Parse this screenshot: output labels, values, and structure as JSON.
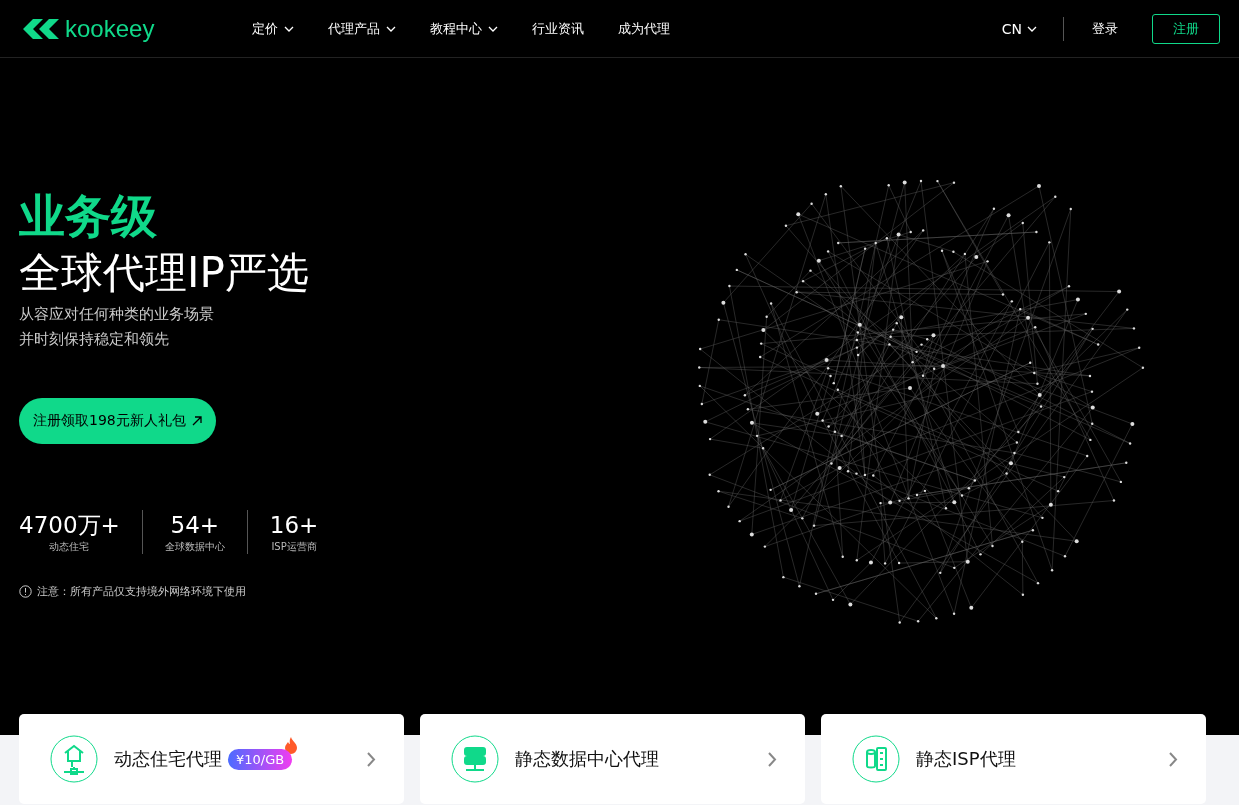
{
  "header": {
    "logo": "kookeey",
    "nav": [
      {
        "label": "定价",
        "dropdown": true
      },
      {
        "label": "代理产品",
        "dropdown": true
      },
      {
        "label": "教程中心",
        "dropdown": true
      },
      {
        "label": "行业资讯",
        "dropdown": false
      },
      {
        "label": "成为代理",
        "dropdown": false
      }
    ],
    "language": "CN",
    "login": "登录",
    "register": "注册"
  },
  "hero": {
    "headline_accent": "业务级",
    "headline": "全球代理IP严选",
    "subtitle_lines": [
      "从容应对任何种类的业务场景",
      "并时刻保持稳定和领先"
    ],
    "cta": "注册领取198元新人礼包",
    "stats": [
      {
        "value": "4700万+",
        "label": "动态住宅"
      },
      {
        "value": "54+",
        "label": "全球数据中心"
      },
      {
        "value": "16+",
        "label": "ISP运营商"
      }
    ],
    "notice": "注意：所有产品仅支持境外网络环境下使用"
  },
  "products": [
    {
      "name": "动态住宅代理",
      "kind": "residential",
      "badge": "¥10/GB"
    },
    {
      "name": "静态数据中心代理",
      "kind": "datacenter"
    },
    {
      "name": "静态ISP代理",
      "kind": "isp"
    }
  ]
}
